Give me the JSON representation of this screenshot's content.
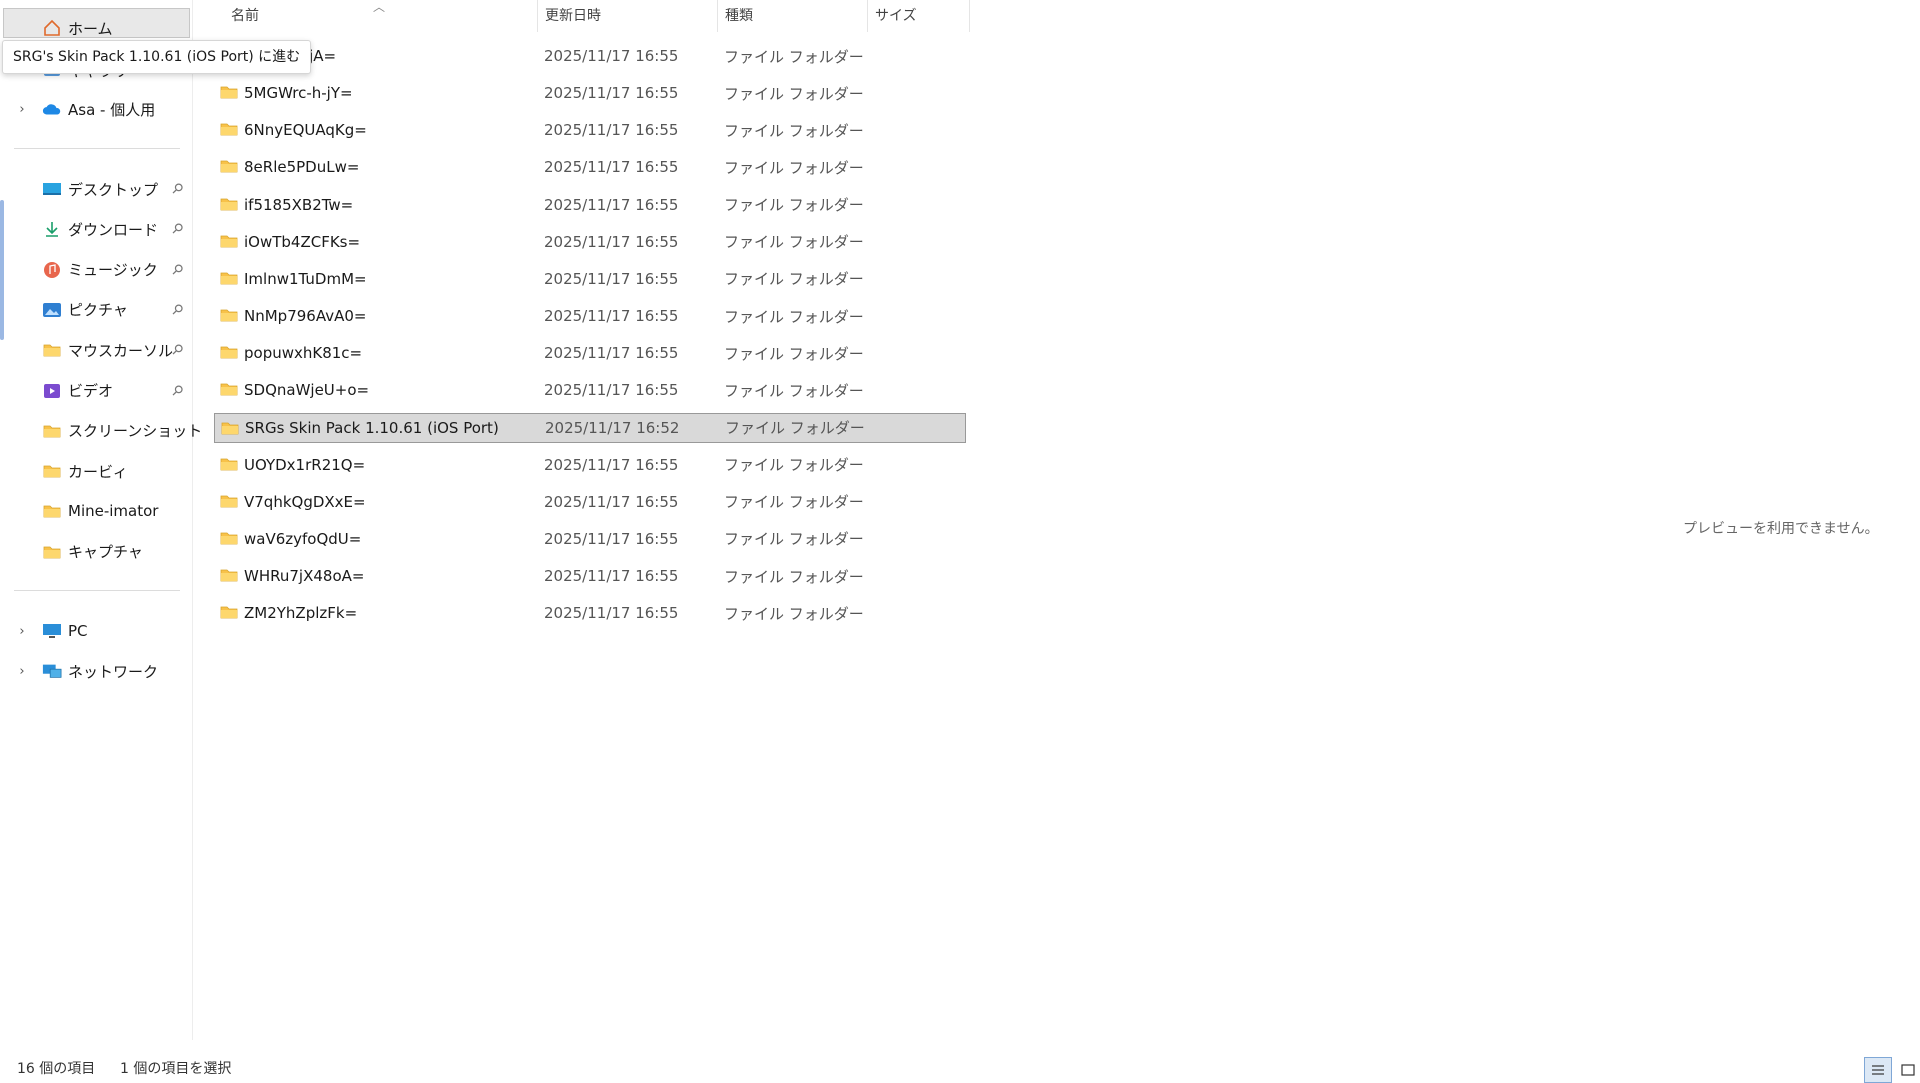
{
  "tooltip": "SRG's Skin Pack 1.10.61 (iOS Port) に進む",
  "sidebar": {
    "top": [
      {
        "label": "ホーム",
        "icon": "home-icon"
      },
      {
        "label": "ギャラリー",
        "icon": "gallery-icon"
      },
      {
        "label": "Asa - 個人用",
        "icon": "onedrive-cloud-icon"
      }
    ],
    "quick_access": [
      {
        "label": "デスクトップ",
        "icon": "desktop-icon",
        "pinned": true
      },
      {
        "label": "ダウンロード",
        "icon": "download-icon",
        "pinned": true
      },
      {
        "label": "ミュージック",
        "icon": "music-icon",
        "pinned": true
      },
      {
        "label": "ピクチャ",
        "icon": "pictures-icon",
        "pinned": true
      },
      {
        "label": "マウスカーソル",
        "icon": "folder-icon",
        "pinned": true
      },
      {
        "label": "ビデオ",
        "icon": "videos-icon",
        "pinned": true
      },
      {
        "label": "スクリーンショット",
        "icon": "folder-icon",
        "pinned": false
      },
      {
        "label": "カービィ",
        "icon": "folder-icon",
        "pinned": false
      },
      {
        "label": "Mine-imator",
        "icon": "folder-icon",
        "pinned": false
      },
      {
        "label": "キャプチャ",
        "icon": "folder-icon",
        "pinned": false
      }
    ],
    "devices": [
      {
        "label": "PC",
        "icon": "pc-icon"
      },
      {
        "label": "ネットワーク",
        "icon": "network-icon"
      }
    ]
  },
  "columns": {
    "name": "名前",
    "date": "更新日時",
    "type": "種類",
    "size": "サイズ"
  },
  "files": [
    {
      "name": "4eFzdWrjA=",
      "date": "2025/11/17 16:55",
      "type": "ファイル フォルダー"
    },
    {
      "name": "5MGWrc-h-jY=",
      "date": "2025/11/17 16:55",
      "type": "ファイル フォルダー"
    },
    {
      "name": "6NnyEQUAqKg=",
      "date": "2025/11/17 16:55",
      "type": "ファイル フォルダー"
    },
    {
      "name": "8eRle5PDuLw=",
      "date": "2025/11/17 16:55",
      "type": "ファイル フォルダー"
    },
    {
      "name": "if5185XB2Tw=",
      "date": "2025/11/17 16:55",
      "type": "ファイル フォルダー"
    },
    {
      "name": "iOwTb4ZCFKs=",
      "date": "2025/11/17 16:55",
      "type": "ファイル フォルダー"
    },
    {
      "name": "Imlnw1TuDmM=",
      "date": "2025/11/17 16:55",
      "type": "ファイル フォルダー"
    },
    {
      "name": "NnMp796AvA0=",
      "date": "2025/11/17 16:55",
      "type": "ファイル フォルダー"
    },
    {
      "name": "popuwxhK81c=",
      "date": "2025/11/17 16:55",
      "type": "ファイル フォルダー"
    },
    {
      "name": "SDQnaWjeU+o=",
      "date": "2025/11/17 16:55",
      "type": "ファイル フォルダー"
    },
    {
      "name": "SRGs Skin Pack 1.10.61 (iOS Port)",
      "date": "2025/11/17 16:52",
      "type": "ファイル フォルダー",
      "selected": true
    },
    {
      "name": "UOYDx1rR21Q=",
      "date": "2025/11/17 16:55",
      "type": "ファイル フォルダー"
    },
    {
      "name": "V7qhkQgDXxE=",
      "date": "2025/11/17 16:55",
      "type": "ファイル フォルダー"
    },
    {
      "name": "waV6zyfoQdU=",
      "date": "2025/11/17 16:55",
      "type": "ファイル フォルダー"
    },
    {
      "name": "WHRu7jX48oA=",
      "date": "2025/11/17 16:55",
      "type": "ファイル フォルダー"
    },
    {
      "name": "ZM2YhZplzFk=",
      "date": "2025/11/17 16:55",
      "type": "ファイル フォルダー"
    }
  ],
  "preview_message": "プレビューを利用できません。",
  "status": {
    "item_count": "16 個の項目",
    "selected_count": "1 個の項目を選択"
  },
  "colors": {
    "accent": "#0067c0",
    "folder": "#f8c24a",
    "selection": "#d9d9d9"
  }
}
